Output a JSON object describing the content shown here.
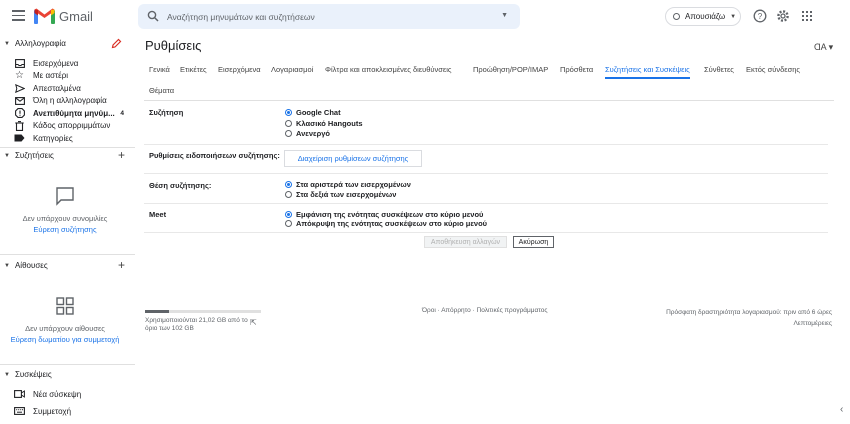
{
  "app": {
    "name": "Gmail"
  },
  "search": {
    "placeholder": "Αναζήτηση μηνυμάτων και συζητήσεων"
  },
  "header": {
    "status": "Απουσιάζω"
  },
  "sidebar": {
    "mail_heading": "Αλληλογραφία",
    "mail_items": [
      {
        "label": "Εισερχόμενα",
        "count": ""
      },
      {
        "label": "Με αστέρι",
        "count": ""
      },
      {
        "label": "Απεσταλμένα",
        "count": ""
      },
      {
        "label": "Όλη η αλληλογραφία",
        "count": ""
      },
      {
        "label": "Ανεπιθύμητα μηνύμ...",
        "count": "4"
      },
      {
        "label": "Κάδος απορριμμάτων",
        "count": ""
      },
      {
        "label": "Κατηγορίες",
        "count": ""
      }
    ],
    "chats_heading": "Συζητήσεις",
    "chats_empty": "Δεν υπάρχουν συνομιλίες",
    "chats_link": "Εύρεση συζήτησης",
    "rooms_heading": "Αίθουσες",
    "rooms_empty": "Δεν υπάρχουν αίθουσες",
    "rooms_link": "Εύρεση δωματίου για συμμετοχή",
    "meet_heading": "Συσκέψεις",
    "meet_items": [
      "Νέα σύσκεψη",
      "Συμμετοχή"
    ]
  },
  "main": {
    "title": "Ρυθμίσεις",
    "tabs": [
      "Γενικά",
      "Ετικέτες",
      "Εισερχόμενα",
      "Λογαριασμοί",
      "Φίλτρα και αποκλεισμένες διευθύνσεις",
      "Προώθηση/POP/IMAP",
      "Πρόσθετα",
      "Συζητήσεις και Συσκέψεις",
      "Σύνθετες",
      "Εκτός σύνδεσης",
      "Θέματα"
    ],
    "active_tab": "Συζητήσεις και Συσκέψεις",
    "sections": {
      "chat_label": "Συζήτηση",
      "chat_options": [
        "Google Chat",
        "Κλασικό Hangouts",
        "Ανενεργό"
      ],
      "notif_label": "Ρυθμίσεις ειδοποιήσεων συζήτησης:",
      "notif_button": "Διαχείριση ρυθμίσεων συζήτησης",
      "position_label": "Θέση συζήτησης:",
      "position_options": [
        "Στα αριστερά των εισερχομένων",
        "Στα δεξιά των εισερχομένων"
      ],
      "meet_label": "Meet",
      "meet_options": [
        "Εμφάνιση της ενότητας συσκέψεων στο κύριο μενού",
        "Απόκρυψη της ενότητας συσκέψεων στο κύριο μενού"
      ]
    },
    "save_button": "Αποθήκευση αλλαγών",
    "cancel_button": "Ακύρωση"
  },
  "footer": {
    "storage": "Χρησιμοποιούνται 21,02 GB από το όριο των 102 GB",
    "storage_fraction": 0.21,
    "terms": "Όροι",
    "privacy": "Απόρρητο",
    "program": "Πολιτικές προγράμματος",
    "activity": "Πρόσφατη δραστηριότητα λογαριασμού: πριν από 6 ώρες",
    "details": "Λεπτομέρειες"
  },
  "colors": {
    "accent": "#1a73e8",
    "logo_red": "#ea4335",
    "logo_blue": "#4285f4",
    "logo_green": "#34a853",
    "logo_yellow": "#fbbc04"
  }
}
